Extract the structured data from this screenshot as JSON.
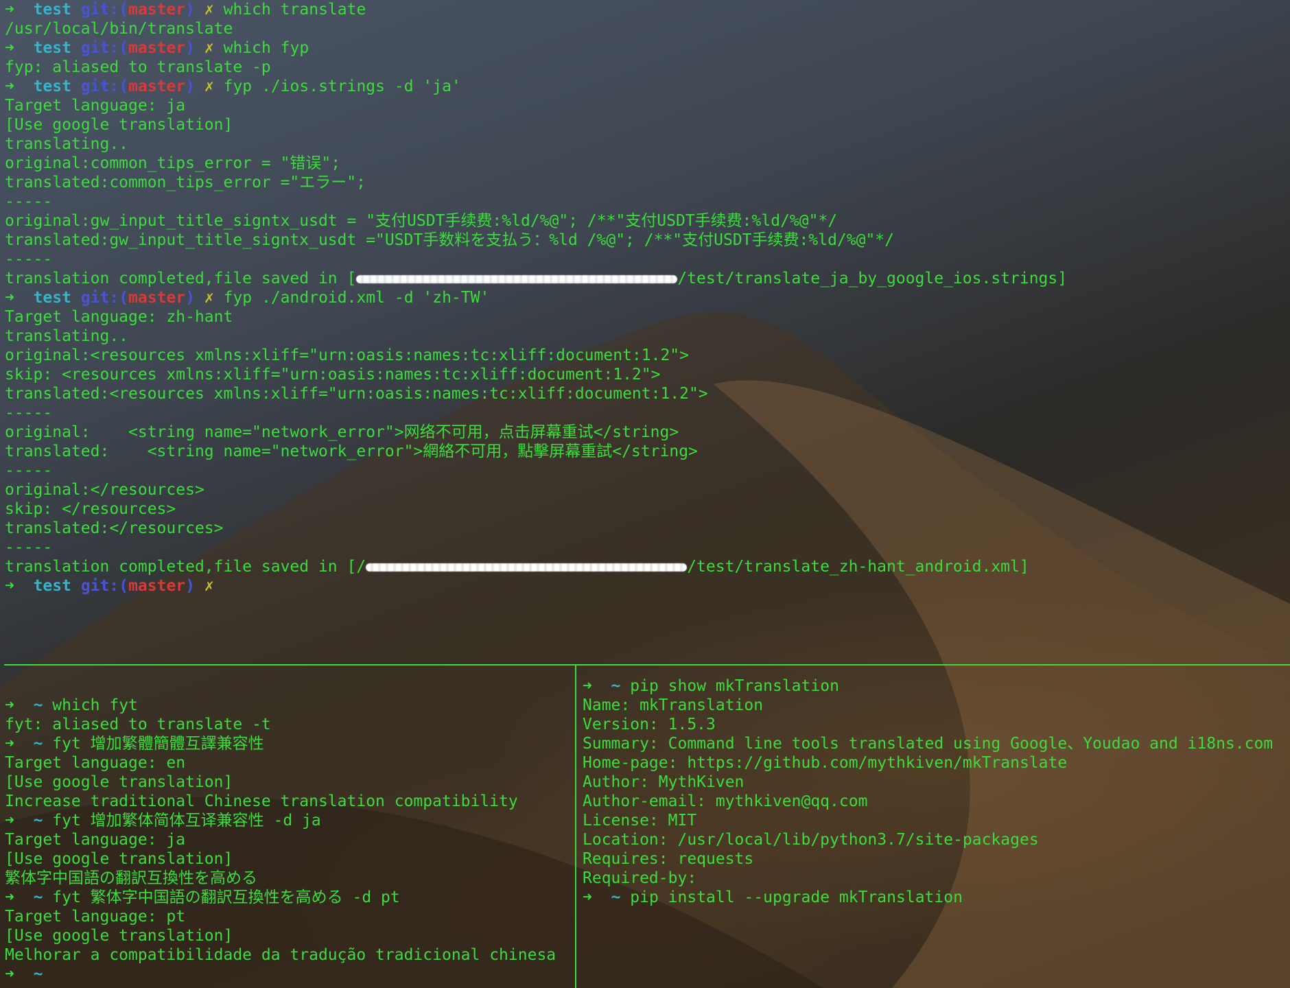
{
  "prompt": {
    "arrow": "➜",
    "dir": "test",
    "git_label": "git:(",
    "branch": "master",
    "git_close": ")",
    "dirty": "✗",
    "home": "~"
  },
  "top_pane": {
    "lines": [
      {
        "kind": "prompt",
        "cmd": "which translate"
      },
      {
        "kind": "out",
        "text": "/usr/local/bin/translate"
      },
      {
        "kind": "prompt",
        "cmd": "which fyp"
      },
      {
        "kind": "out",
        "text": "fyp: aliased to translate -p"
      },
      {
        "kind": "prompt",
        "cmd": "fyp ./ios.strings -d 'ja'"
      },
      {
        "kind": "out",
        "text": "Target language: ja"
      },
      {
        "kind": "out",
        "text": "[Use google translation]"
      },
      {
        "kind": "out",
        "text": "translating.."
      },
      {
        "kind": "out",
        "text": "original:common_tips_error = \"错误\";"
      },
      {
        "kind": "out",
        "text": "translated:common_tips_error =\"エラー\";"
      },
      {
        "kind": "out",
        "text": "-----"
      },
      {
        "kind": "out",
        "text": "original:gw_input_title_signtx_usdt = \"支付USDT手续费:%ld/%@\"; /**\"支付USDT手续费:%ld/%@\"*/"
      },
      {
        "kind": "out",
        "text": "translated:gw_input_title_signtx_usdt =\"USDT手数料を支払う：%ld /%@\"; /**\"支付USDT手续费:%ld/%@\"*/"
      },
      {
        "kind": "out",
        "text": "-----"
      },
      {
        "kind": "saved",
        "before": "translation completed,file saved in [",
        "after": "/test/translate_ja_by_google_ios.strings]"
      },
      {
        "kind": "prompt",
        "cmd": "fyp ./android.xml -d 'zh-TW'"
      },
      {
        "kind": "out",
        "text": "Target language: zh-hant"
      },
      {
        "kind": "out",
        "text": "translating.."
      },
      {
        "kind": "out",
        "text": "original:<resources xmlns:xliff=\"urn:oasis:names:tc:xliff:document:1.2\">"
      },
      {
        "kind": "out",
        "text": "skip: <resources xmlns:xliff=\"urn:oasis:names:tc:xliff:document:1.2\">"
      },
      {
        "kind": "out",
        "text": "translated:<resources xmlns:xliff=\"urn:oasis:names:tc:xliff:document:1.2\">"
      },
      {
        "kind": "out",
        "text": "-----"
      },
      {
        "kind": "out",
        "text": "original:    <string name=\"network_error\">网络不可用，点击屏幕重试</string>"
      },
      {
        "kind": "out",
        "text": "translated:    <string name=\"network_error\">網絡不可用，點擊屏幕重試</string>"
      },
      {
        "kind": "out",
        "text": "-----"
      },
      {
        "kind": "out",
        "text": "original:</resources>"
      },
      {
        "kind": "out",
        "text": "skip: </resources>"
      },
      {
        "kind": "out",
        "text": "translated:</resources>"
      },
      {
        "kind": "out",
        "text": "-----"
      },
      {
        "kind": "saved",
        "before": "translation completed,file saved in [/",
        "after": "/test/translate_zh-hant_android.xml]"
      },
      {
        "kind": "prompt",
        "cmd": ""
      }
    ]
  },
  "bottom_left_pane": {
    "lines": [
      {
        "kind": "home",
        "cmd": "which fyt"
      },
      {
        "kind": "out",
        "text": "fyt: aliased to translate -t"
      },
      {
        "kind": "home",
        "cmd": "fyt 增加繁體簡體互譯兼容性"
      },
      {
        "kind": "out",
        "text": "Target language: en"
      },
      {
        "kind": "out",
        "text": "[Use google translation]"
      },
      {
        "kind": "out",
        "text": "Increase traditional Chinese translation compatibility"
      },
      {
        "kind": "home",
        "cmd": "fyt 增加繁体简体互译兼容性 -d ja"
      },
      {
        "kind": "out",
        "text": "Target language: ja"
      },
      {
        "kind": "out",
        "text": "[Use google translation]"
      },
      {
        "kind": "out",
        "text": "繁体字中国語の翻訳互換性を高める"
      },
      {
        "kind": "home",
        "cmd": "fyt 繁体字中国語の翻訳互換性を高める -d pt"
      },
      {
        "kind": "out",
        "text": "Target language: pt"
      },
      {
        "kind": "out",
        "text": "[Use google translation]"
      },
      {
        "kind": "out",
        "text": "Melhorar a compatibilidade da tradução tradicional chinesa"
      },
      {
        "kind": "home",
        "cmd": ""
      }
    ]
  },
  "bottom_right_pane": {
    "lines": [
      {
        "kind": "home",
        "cmd": "pip show mkTranslation"
      },
      {
        "kind": "out",
        "text": "Name: mkTranslation"
      },
      {
        "kind": "out",
        "text": "Version: 1.5.3"
      },
      {
        "kind": "out",
        "text": "Summary: Command line tools translated using Google、Youdao and i18ns.com"
      },
      {
        "kind": "out",
        "text": "Home-page: https://github.com/mythkiven/mkTranslate"
      },
      {
        "kind": "out",
        "text": "Author: MythKiven"
      },
      {
        "kind": "out",
        "text": "Author-email: mythkiven@qq.com"
      },
      {
        "kind": "out",
        "text": "License: MIT"
      },
      {
        "kind": "out",
        "text": "Location: /usr/local/lib/python3.7/site-packages"
      },
      {
        "kind": "out",
        "text": "Requires: requests"
      },
      {
        "kind": "out",
        "text": "Required-by:"
      },
      {
        "kind": "home",
        "cmd": "pip install --upgrade mkTranslation"
      }
    ]
  },
  "colors": {
    "text": "#3ddc3d",
    "dir": "#39b3c8",
    "git": "#4a52d6",
    "branch": "#d53b3b",
    "dirty": "#c9c22a"
  }
}
